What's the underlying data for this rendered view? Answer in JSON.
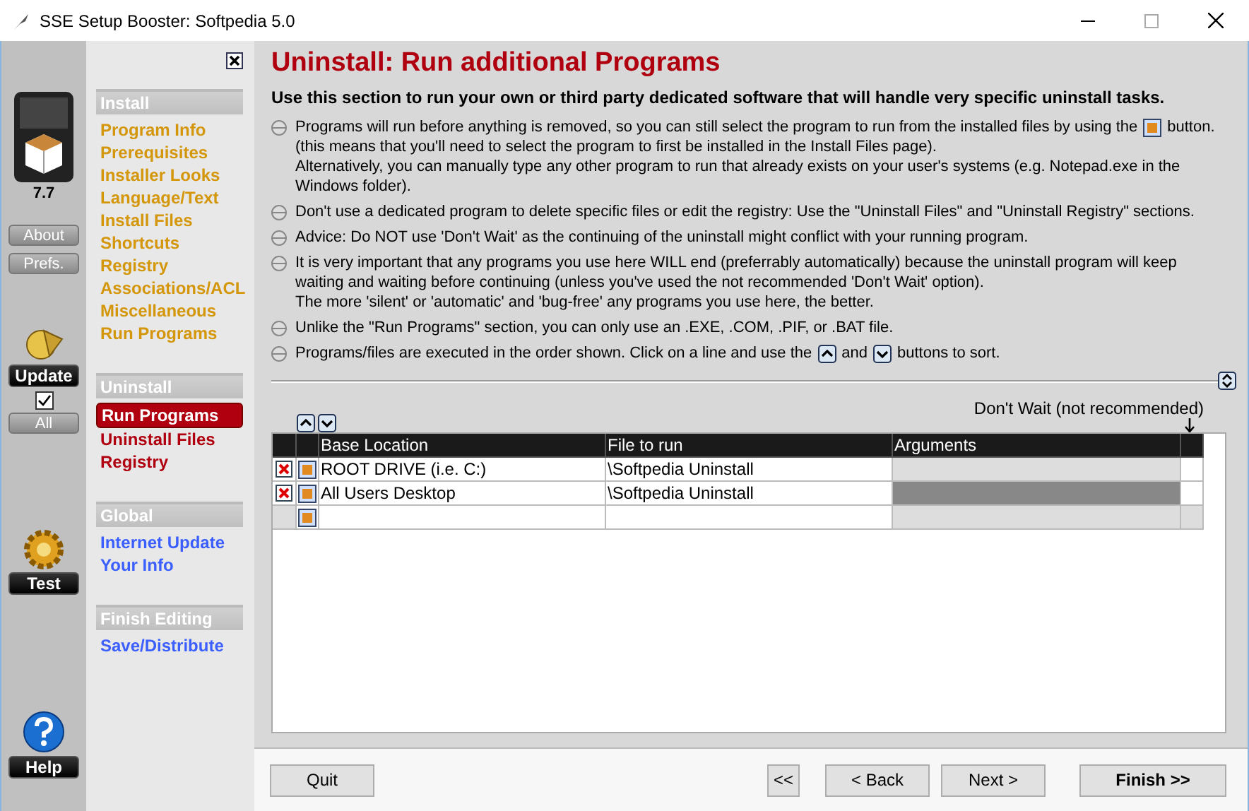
{
  "window": {
    "title": "SSE Setup Booster: Softpedia 5.0"
  },
  "sidebar": {
    "version": "7.7",
    "buttons": [
      {
        "label": "About"
      },
      {
        "label": "Prefs."
      }
    ],
    "update_label": "Update",
    "update_all": {
      "checked": true,
      "label": "All"
    },
    "test_label": "Test",
    "help_label": "Help"
  },
  "nav": [
    {
      "header": "Install",
      "color": "#d4960a",
      "items": [
        {
          "label": "Program Info",
          "selected": false
        },
        {
          "label": "Prerequisites",
          "selected": false
        },
        {
          "label": "Installer Looks",
          "selected": false
        },
        {
          "label": "Language/Text",
          "selected": false
        },
        {
          "label": "Install Files",
          "selected": false
        },
        {
          "label": "Shortcuts",
          "selected": false
        },
        {
          "label": "Registry",
          "selected": false
        },
        {
          "label": "Associations/ACL",
          "selected": false
        },
        {
          "label": "Miscellaneous",
          "selected": false
        },
        {
          "label": "Run Programs",
          "selected": false
        }
      ]
    },
    {
      "header": "Uninstall",
      "color": "#b00010",
      "items": [
        {
          "label": "Run Programs",
          "selected": true
        },
        {
          "label": "Uninstall Files",
          "selected": false
        },
        {
          "label": "Registry",
          "selected": false
        }
      ]
    },
    {
      "header": "Global",
      "color": "#3a5eff",
      "items": [
        {
          "label": "Internet Update",
          "selected": false
        },
        {
          "label": "Your Info",
          "selected": false
        }
      ]
    },
    {
      "header": "Finish Editing",
      "color": "#3a5eff",
      "items": [
        {
          "label": "Save/Distribute",
          "selected": false
        }
      ]
    }
  ],
  "page": {
    "title": "Uninstall: Run additional Programs",
    "subtitle": "Use this section to run your own or third party dedicated software that will handle very specific uninstall tasks.",
    "bullets": [
      [
        [
          {
            "kind": "text",
            "text": "Programs will run before anything is removed, so you can still select the program to run from the installed files by using the"
          },
          {
            "kind": "program"
          },
          {
            "kind": "text",
            "text": "button."
          }
        ],
        [
          {
            "kind": "text",
            "text": "(this means that you'll need to select the program to first be installed in the Install Files page)."
          }
        ],
        [
          {
            "kind": "text",
            "text": "Alternatively, you can manually type any other program to run that already exists on your user's systems (e.g. Notepad.exe in the Windows folder)."
          }
        ]
      ],
      [
        [
          {
            "kind": "text",
            "text": "Don't use a dedicated program to delete specific files or edit the registry: Use the \"Uninstall Files\" and \"Uninstall Registry\" sections."
          }
        ]
      ],
      [
        [
          {
            "kind": "text",
            "text": "Advice: Do NOT use 'Don't Wait' as the continuing of the uninstall might conflict with your running program."
          }
        ]
      ],
      [
        [
          {
            "kind": "text",
            "text": "It is very important that any programs you use here WILL end (preferrably automatically) because the uninstall program will keep waiting and waiting before continuing (unless you've used the not recommended 'Don't Wait' option)."
          }
        ],
        [
          {
            "kind": "text",
            "text": "The more 'silent' or 'automatic' and 'bug-free' any programs you use here, the better."
          }
        ]
      ],
      [
        [
          {
            "kind": "text",
            "text": "Unlike the \"Run Programs\" section, you can only use an .EXE, .COM, .PIF, or .BAT file."
          }
        ]
      ],
      [
        [
          {
            "kind": "text",
            "text": "Programs/files are executed in the order shown. Click on a line and use the"
          },
          {
            "kind": "up"
          },
          {
            "kind": "text",
            "text": "and"
          },
          {
            "kind": "down"
          },
          {
            "kind": "text",
            "text": "buttons to sort."
          }
        ]
      ]
    ]
  },
  "table": {
    "dont_wait_label": "Don't Wait (not recommended)",
    "columns": [
      "Base Location",
      "File to run",
      "Arguments"
    ],
    "rows": [
      {
        "kind": "entry",
        "base": "ROOT DRIVE (i.e. C:)",
        "file": "\\Softpedia Uninstall",
        "selected": false
      },
      {
        "kind": "entry",
        "base": "All Users Desktop",
        "file": "\\Softpedia Uninstall",
        "selected": true
      },
      {
        "kind": "new",
        "selected": false
      }
    ]
  },
  "footer": {
    "quit": "Quit",
    "first": "<<",
    "back": "< Back",
    "next": "Next >",
    "finish": "Finish >>"
  }
}
